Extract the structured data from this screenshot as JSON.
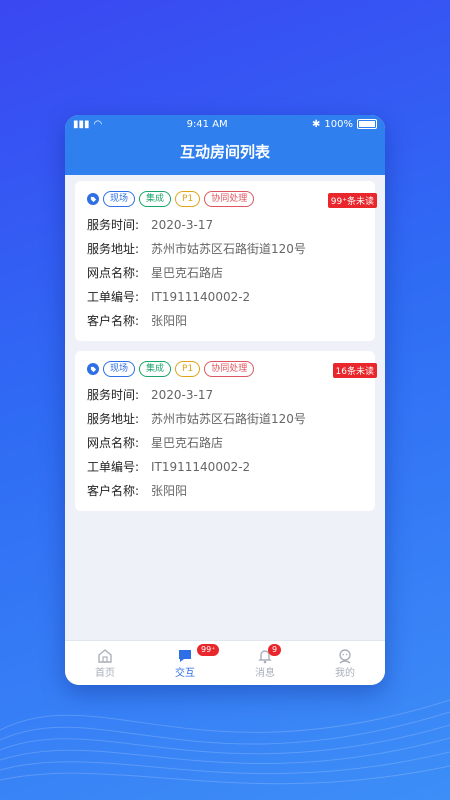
{
  "status_bar": {
    "time": "9:41 AM",
    "battery": "100%"
  },
  "header": {
    "title": "互动房间列表"
  },
  "cards": [
    {
      "tags": [
        "现场",
        "集成",
        "P1",
        "协同处理"
      ],
      "unread": "99⁺条未读",
      "fields": [
        {
          "label": "服务时间:",
          "value": "2020-3-17"
        },
        {
          "label": "服务地址:",
          "value": "苏州市姑苏区石路街道120号"
        },
        {
          "label": "网点名称:",
          "value": "星巴克石路店"
        },
        {
          "label": "工单编号:",
          "value": "IT1911140002-2"
        },
        {
          "label": "客户名称:",
          "value": "张阳阳"
        }
      ]
    },
    {
      "tags": [
        "现场",
        "集成",
        "P1",
        "协同处理"
      ],
      "unread": "16条未读",
      "fields": [
        {
          "label": "服务时间:",
          "value": "2020-3-17"
        },
        {
          "label": "服务地址:",
          "value": "苏州市姑苏区石路街道120号"
        },
        {
          "label": "网点名称:",
          "value": "星巴克石路店"
        },
        {
          "label": "工单编号:",
          "value": "IT1911140002-2"
        },
        {
          "label": "客户名称:",
          "value": "张阳阳"
        }
      ]
    }
  ],
  "tab_bar": [
    {
      "label": "首页",
      "icon": "home-icon",
      "active": false,
      "badge": ""
    },
    {
      "label": "交互",
      "icon": "chat-icon",
      "active": true,
      "badge": "99⁺"
    },
    {
      "label": "消息",
      "icon": "bell-icon",
      "active": false,
      "badge": "9"
    },
    {
      "label": "我的",
      "icon": "user-icon",
      "active": false,
      "badge": ""
    }
  ],
  "colors": {
    "accent": "#2f80ee",
    "badge": "#e8262b",
    "tag_blue": "#2f6fe6",
    "tag_green": "#1aa56a",
    "tag_yellow": "#e0a31a",
    "tag_red": "#e05660"
  }
}
